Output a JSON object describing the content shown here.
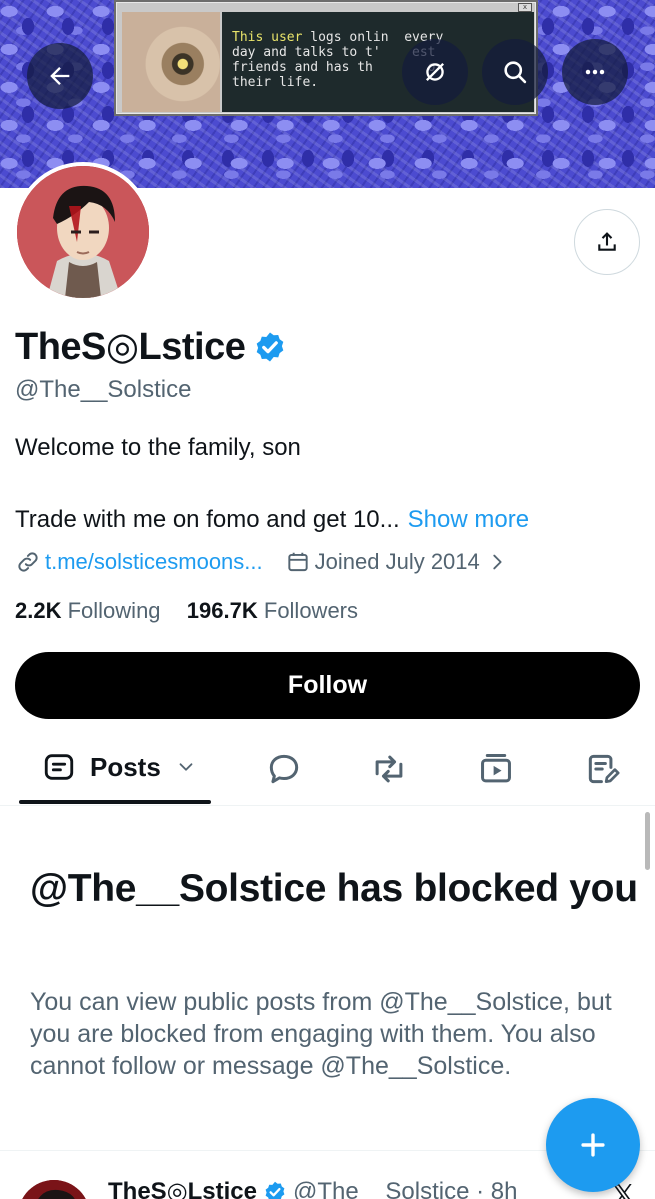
{
  "banner": {
    "retro_text_highlight": "This user",
    "retro_text_rest": " logs onlin  every\nday and talks to t'    est\nfriends and has th       o\ntheir life.",
    "close_glyph": "x"
  },
  "nav": {
    "back_icon": "arrow-left-icon",
    "mute_icon": "circle-slash-icon",
    "search_icon": "search-icon",
    "more_icon": "more-horizontal-icon"
  },
  "profile": {
    "display_name": "TheS◎Lstice",
    "handle": "@The__Solstice",
    "bio_line_1": "Welcome to the family, son",
    "bio_line_2": "Trade with me on fomo and get 10...",
    "show_more": "Show more",
    "link": "t.me/solsticesmoons...",
    "joined": "Joined July 2014",
    "following_count": "2.2K",
    "following_label": "Following",
    "followers_count": "196.7K",
    "followers_label": "Followers",
    "follow_label": "Follow"
  },
  "tabs": {
    "posts_label": "Posts",
    "icons": [
      "posts-icon",
      "replies-icon",
      "reposts-icon",
      "media-icon",
      "articles-icon"
    ]
  },
  "blocked": {
    "title": "@The__Solstice has blocked you",
    "description": "You can view public posts from @The__Solstice, but you are blocked from engaging with them. You also cannot follow or message @The__Solstice."
  },
  "next_post": {
    "name": "TheS◎Lstice",
    "meta": "@The__Solstice · 8h"
  },
  "colors": {
    "accent": "#1d9bf0",
    "text_primary": "#0f1419",
    "text_secondary": "#536471",
    "follow_button": "#000000"
  }
}
